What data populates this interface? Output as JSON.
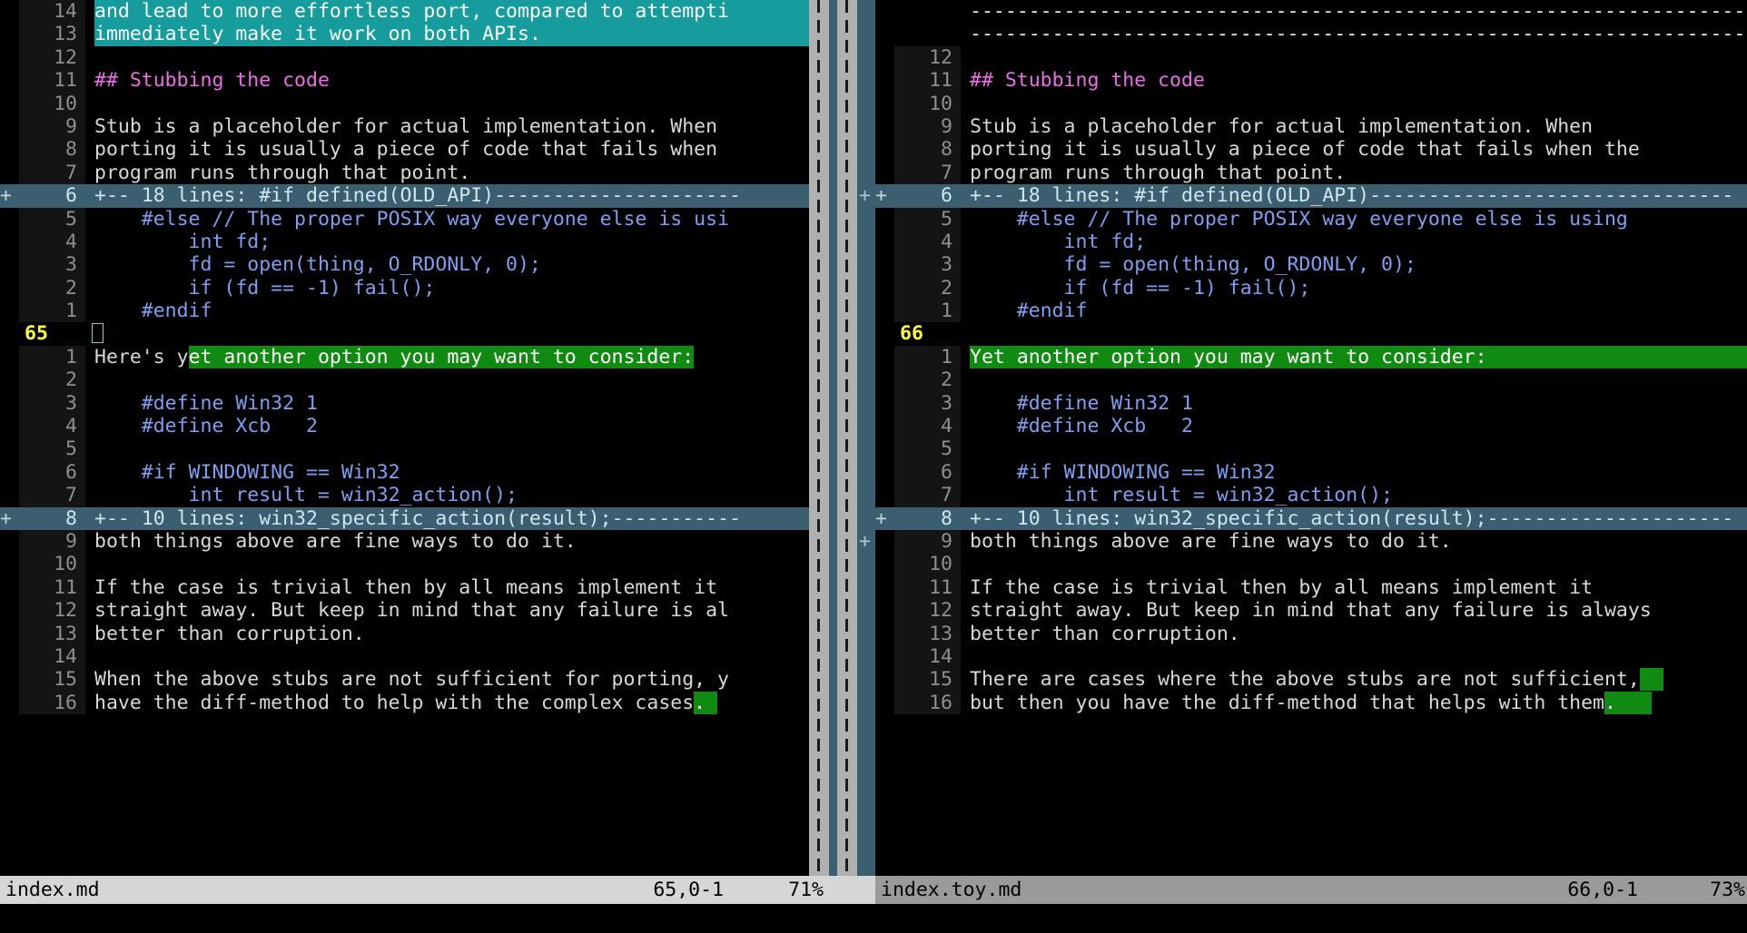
{
  "app": {
    "name": "vim-diff",
    "theme_bg": "#000000"
  },
  "colors": {
    "diff_change": "#169c9c",
    "diff_add": "#108a10",
    "fold": "#3b5e70",
    "heading": "#ee6ee8",
    "code": "#7f9ff2",
    "current_line_number": "#ffff3a",
    "scrollbar": "#b0b0b0",
    "statusbar_active": "#d6d6d6",
    "statusbar_inactive": "#9a9a9a"
  },
  "left_pane": {
    "file": "index.md",
    "status": {
      "filename": "index.md",
      "ruler": "65,0-1",
      "percent": "71%"
    },
    "rows": [
      {
        "sign": "",
        "num": "14",
        "kind": "normal",
        "segments": [
          {
            "text": "and lead to more effortless port, compared to attempti",
            "style": "change"
          }
        ]
      },
      {
        "sign": "",
        "num": "13",
        "kind": "normal",
        "segments": [
          {
            "text": "immediately make it work on both APIs.",
            "style": "change"
          }
        ]
      },
      {
        "sign": "",
        "num": "12",
        "kind": "normal",
        "segments": []
      },
      {
        "sign": "",
        "num": "11",
        "kind": "normal",
        "segments": [
          {
            "text": "## Stubbing the code",
            "style": "heading"
          }
        ]
      },
      {
        "sign": "",
        "num": "10",
        "kind": "normal",
        "segments": []
      },
      {
        "sign": "",
        "num": "9",
        "kind": "normal",
        "segments": [
          {
            "text": "Stub is a placeholder for actual implementation. When",
            "style": "plain"
          }
        ]
      },
      {
        "sign": "",
        "num": "8",
        "kind": "normal",
        "segments": [
          {
            "text": "porting it is usually a piece of code that fails when",
            "style": "plain"
          }
        ]
      },
      {
        "sign": "",
        "num": "7",
        "kind": "normal",
        "segments": [
          {
            "text": "program runs through that point.",
            "style": "plain"
          }
        ]
      },
      {
        "sign": "+",
        "num": "6",
        "kind": "fold",
        "segments": [
          {
            "text": "+-- 18 lines: #if defined(OLD_API)---------------------",
            "style": "plain"
          }
        ]
      },
      {
        "sign": "",
        "num": "5",
        "kind": "normal",
        "segments": [
          {
            "text": "    #else // The proper POSIX way everyone else is usi",
            "style": "code"
          }
        ]
      },
      {
        "sign": "",
        "num": "4",
        "kind": "normal",
        "segments": [
          {
            "text": "        int fd;",
            "style": "code"
          }
        ]
      },
      {
        "sign": "",
        "num": "3",
        "kind": "normal",
        "segments": [
          {
            "text": "        fd = open(thing, O_RDONLY, 0);",
            "style": "code"
          }
        ]
      },
      {
        "sign": "",
        "num": "2",
        "kind": "normal",
        "segments": [
          {
            "text": "        if (fd == -1) fail();",
            "style": "code"
          }
        ]
      },
      {
        "sign": "",
        "num": "1",
        "kind": "normal",
        "segments": [
          {
            "text": "    #endif",
            "style": "code"
          }
        ]
      },
      {
        "sign": "",
        "num": "65",
        "kind": "current",
        "segments": [
          {
            "text": "",
            "style": "cursor"
          }
        ]
      },
      {
        "sign": "",
        "num": "1",
        "kind": "normal",
        "segments": [
          {
            "text": "Here's y",
            "style": "plain"
          },
          {
            "text": "et another option you may want to consider:",
            "style": "add"
          }
        ]
      },
      {
        "sign": "",
        "num": "2",
        "kind": "normal",
        "segments": []
      },
      {
        "sign": "",
        "num": "3",
        "kind": "normal",
        "segments": [
          {
            "text": "    #define Win32 1",
            "style": "code"
          }
        ]
      },
      {
        "sign": "",
        "num": "4",
        "kind": "normal",
        "segments": [
          {
            "text": "    #define Xcb   2",
            "style": "code"
          }
        ]
      },
      {
        "sign": "",
        "num": "5",
        "kind": "normal",
        "segments": []
      },
      {
        "sign": "",
        "num": "6",
        "kind": "normal",
        "segments": [
          {
            "text": "    #if WINDOWING == Win32",
            "style": "code"
          }
        ]
      },
      {
        "sign": "",
        "num": "7",
        "kind": "normal",
        "segments": [
          {
            "text": "        int result = win32_action();",
            "style": "code"
          }
        ]
      },
      {
        "sign": "+",
        "num": "8",
        "kind": "fold",
        "segments": [
          {
            "text": "+-- 10 lines: win32_specific_action(result);-----------",
            "style": "plain"
          }
        ]
      },
      {
        "sign": "",
        "num": "9",
        "kind": "normal",
        "segments": [
          {
            "text": "both things above are fine ways to do it.",
            "style": "plain"
          }
        ]
      },
      {
        "sign": "",
        "num": "10",
        "kind": "normal",
        "segments": []
      },
      {
        "sign": "",
        "num": "11",
        "kind": "normal",
        "segments": [
          {
            "text": "If the case is trivial then by all means implement it",
            "style": "plain"
          }
        ]
      },
      {
        "sign": "",
        "num": "12",
        "kind": "normal",
        "segments": [
          {
            "text": "straight away. But keep in mind that any failure is al",
            "style": "plain"
          }
        ]
      },
      {
        "sign": "",
        "num": "13",
        "kind": "normal",
        "segments": [
          {
            "text": "better than corruption.",
            "style": "plain"
          }
        ]
      },
      {
        "sign": "",
        "num": "14",
        "kind": "normal",
        "segments": []
      },
      {
        "sign": "",
        "num": "15",
        "kind": "normal",
        "segments": [
          {
            "text": "When the above stubs are not sufficient for porting, y",
            "style": "plain"
          }
        ]
      },
      {
        "sign": "",
        "num": "16",
        "kind": "normal",
        "segments": [
          {
            "text": "have the diff-method to help with the complex cases",
            "style": "plain"
          },
          {
            "text": ".",
            "style": "add"
          },
          {
            "text": " ",
            "style": "add"
          }
        ]
      }
    ]
  },
  "right_pane": {
    "file": "index.toy.md",
    "status": {
      "filename": "index.toy.md",
      "ruler": "66,0-1",
      "percent": "73%"
    },
    "rows": [
      {
        "sign": "",
        "num": "",
        "kind": "filler",
        "segments": [
          {
            "text": "-------------------------------------------------------------------",
            "style": "dash"
          }
        ]
      },
      {
        "sign": "",
        "num": "",
        "kind": "filler",
        "segments": [
          {
            "text": "-------------------------------------------------------------------",
            "style": "dash"
          }
        ]
      },
      {
        "sign": "",
        "num": "12",
        "kind": "normal",
        "segments": []
      },
      {
        "sign": "",
        "num": "11",
        "kind": "normal",
        "segments": [
          {
            "text": "## Stubbing the code",
            "style": "heading"
          }
        ]
      },
      {
        "sign": "",
        "num": "10",
        "kind": "normal",
        "segments": []
      },
      {
        "sign": "",
        "num": "9",
        "kind": "normal",
        "segments": [
          {
            "text": "Stub is a placeholder for actual implementation. When",
            "style": "plain"
          }
        ]
      },
      {
        "sign": "",
        "num": "8",
        "kind": "normal",
        "segments": [
          {
            "text": "porting it is usually a piece of code that fails when the",
            "style": "plain"
          }
        ]
      },
      {
        "sign": "",
        "num": "7",
        "kind": "normal",
        "segments": [
          {
            "text": "program runs through that point.",
            "style": "plain"
          }
        ]
      },
      {
        "sign": "+",
        "num": "6",
        "kind": "fold",
        "segments": [
          {
            "text": "+-- 18 lines: #if defined(OLD_API)-------------------------------",
            "style": "plain"
          }
        ]
      },
      {
        "sign": "",
        "num": "5",
        "kind": "normal",
        "segments": [
          {
            "text": "    #else // The proper POSIX way everyone else is using",
            "style": "code"
          }
        ]
      },
      {
        "sign": "",
        "num": "4",
        "kind": "normal",
        "segments": [
          {
            "text": "        int fd;",
            "style": "code"
          }
        ]
      },
      {
        "sign": "",
        "num": "3",
        "kind": "normal",
        "segments": [
          {
            "text": "        fd = open(thing, O_RDONLY, 0);",
            "style": "code"
          }
        ]
      },
      {
        "sign": "",
        "num": "2",
        "kind": "normal",
        "segments": [
          {
            "text": "        if (fd == -1) fail();",
            "style": "code"
          }
        ]
      },
      {
        "sign": "",
        "num": "1",
        "kind": "normal",
        "segments": [
          {
            "text": "    #endif",
            "style": "code"
          }
        ]
      },
      {
        "sign": "",
        "num": "66",
        "kind": "current",
        "segments": []
      },
      {
        "sign": "",
        "num": "1",
        "kind": "normal",
        "segments": [
          {
            "text": "Yet another option you may want to consider:",
            "style": "add-full"
          }
        ]
      },
      {
        "sign": "",
        "num": "2",
        "kind": "normal",
        "segments": []
      },
      {
        "sign": "",
        "num": "3",
        "kind": "normal",
        "segments": [
          {
            "text": "    #define Win32 1",
            "style": "code"
          }
        ]
      },
      {
        "sign": "",
        "num": "4",
        "kind": "normal",
        "segments": [
          {
            "text": "    #define Xcb   2",
            "style": "code"
          }
        ]
      },
      {
        "sign": "",
        "num": "5",
        "kind": "normal",
        "segments": []
      },
      {
        "sign": "",
        "num": "6",
        "kind": "normal",
        "segments": [
          {
            "text": "    #if WINDOWING == Win32",
            "style": "code"
          }
        ]
      },
      {
        "sign": "",
        "num": "7",
        "kind": "normal",
        "segments": [
          {
            "text": "        int result = win32_action();",
            "style": "code"
          }
        ]
      },
      {
        "sign": "+",
        "num": "8",
        "kind": "fold",
        "segments": [
          {
            "text": "+-- 10 lines: win32_specific_action(result);---------------------",
            "style": "plain"
          }
        ]
      },
      {
        "sign": "",
        "num": "9",
        "kind": "normal",
        "segments": [
          {
            "text": "both things above are fine ways to do it.",
            "style": "plain"
          }
        ]
      },
      {
        "sign": "",
        "num": "10",
        "kind": "normal",
        "segments": []
      },
      {
        "sign": "",
        "num": "11",
        "kind": "normal",
        "segments": [
          {
            "text": "If the case is trivial then by all means implement it",
            "style": "plain"
          }
        ]
      },
      {
        "sign": "",
        "num": "12",
        "kind": "normal",
        "segments": [
          {
            "text": "straight away. But keep in mind that any failure is always",
            "style": "plain"
          }
        ]
      },
      {
        "sign": "",
        "num": "13",
        "kind": "normal",
        "segments": [
          {
            "text": "better than corruption.",
            "style": "plain"
          }
        ]
      },
      {
        "sign": "",
        "num": "14",
        "kind": "normal",
        "segments": []
      },
      {
        "sign": "",
        "num": "15",
        "kind": "normal",
        "segments": [
          {
            "text": "There are cases where the above stubs are not sufficient,",
            "style": "plain"
          },
          {
            "text": "  ",
            "style": "add"
          }
        ]
      },
      {
        "sign": "",
        "num": "16",
        "kind": "normal",
        "segments": [
          {
            "text": "but then you have the diff-method that helps with them",
            "style": "plain"
          },
          {
            "text": ".",
            "style": "add"
          },
          {
            "text": "   ",
            "style": "add"
          }
        ]
      }
    ]
  }
}
